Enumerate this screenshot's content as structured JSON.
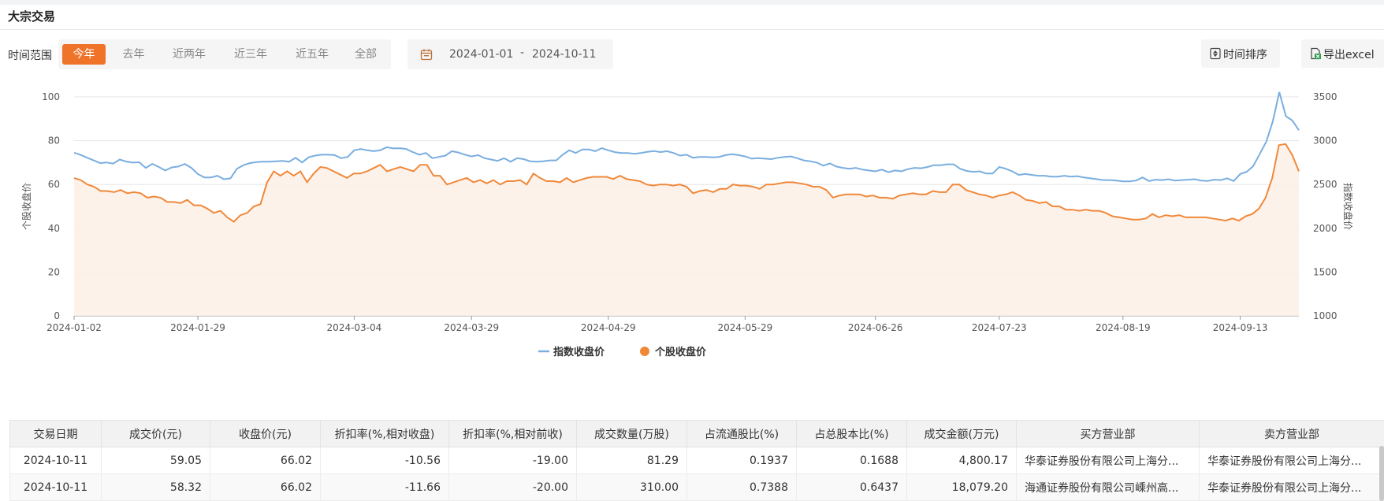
{
  "header": {
    "title": "大宗交易"
  },
  "filter": {
    "label": "时间范围",
    "ranges": [
      "今年",
      "去年",
      "近两年",
      "近三年",
      "近五年",
      "全部"
    ],
    "active_index": 0,
    "date_from": "2024-01-01",
    "date_sep": "-",
    "date_to": "2024-10-11"
  },
  "toolbar": {
    "sort_label": "时间排序",
    "export_label": "导出excel"
  },
  "icons": {
    "calendar": "calendar-icon",
    "sort": "sort-icon",
    "export": "excel-export-icon"
  },
  "colors": {
    "accent": "#f0732a",
    "stock_line": "#f0883a",
    "index_line": "#7aaedf",
    "stock_fill": "#fdf0e6"
  },
  "chart_data": {
    "type": "line",
    "x_ticks": [
      "2024-01-02",
      "2024-01-29",
      "2024-03-04",
      "2024-03-29",
      "2024-04-29",
      "2024-05-29",
      "2024-06-26",
      "2024-07-23",
      "2024-08-19",
      "2024-09-13"
    ],
    "ylabel_left": "个股收盘价",
    "ylabel_right": "指数收盘价",
    "ylim_left": [
      0,
      100
    ],
    "ylim_right": [
      1000,
      3500
    ],
    "y_ticks_left": [
      "0",
      "20",
      "40",
      "60",
      "80",
      "100"
    ],
    "y_ticks_right": [
      "1000",
      "1500",
      "2000",
      "2500",
      "3000",
      "3500"
    ],
    "legend_position": "bottom",
    "grid": true,
    "series": [
      {
        "name": "指数收盘价",
        "axis": "right",
        "values": [
          2862,
          2838,
          2806,
          2775,
          2744,
          2752,
          2738,
          2785,
          2762,
          2750,
          2754,
          2690,
          2735,
          2700,
          2660,
          2695,
          2705,
          2735,
          2690,
          2620,
          2580,
          2580,
          2600,
          2560,
          2570,
          2680,
          2720,
          2745,
          2755,
          2760,
          2760,
          2765,
          2770,
          2760,
          2805,
          2752,
          2810,
          2830,
          2840,
          2840,
          2835,
          2800,
          2815,
          2890,
          2905,
          2890,
          2880,
          2890,
          2925,
          2912,
          2915,
          2905,
          2870,
          2840,
          2860,
          2800,
          2815,
          2830,
          2880,
          2865,
          2840,
          2820,
          2835,
          2800,
          2785,
          2770,
          2800,
          2760,
          2800,
          2790,
          2765,
          2760,
          2765,
          2775,
          2775,
          2840,
          2890,
          2860,
          2900,
          2900,
          2880,
          2915,
          2890,
          2870,
          2860,
          2860,
          2850,
          2860,
          2872,
          2882,
          2870,
          2880,
          2860,
          2830,
          2840,
          2805,
          2815,
          2815,
          2810,
          2815,
          2835,
          2845,
          2835,
          2820,
          2795,
          2800,
          2795,
          2790,
          2805,
          2815,
          2820,
          2800,
          2775,
          2765,
          2750,
          2715,
          2740,
          2705,
          2690,
          2680,
          2690,
          2670,
          2660,
          2650,
          2670,
          2640,
          2660,
          2650,
          2675,
          2690,
          2685,
          2700,
          2720,
          2720,
          2730,
          2730,
          2680,
          2655,
          2645,
          2650,
          2625,
          2625,
          2700,
          2680,
          2650,
          2610,
          2620,
          2610,
          2600,
          2600,
          2590,
          2590,
          2600,
          2590,
          2595,
          2580,
          2570,
          2560,
          2550,
          2550,
          2545,
          2535,
          2535,
          2545,
          2580,
          2540,
          2555,
          2550,
          2560,
          2545,
          2550,
          2555,
          2560,
          2545,
          2540,
          2555,
          2550,
          2570,
          2540,
          2620,
          2645,
          2710,
          2850,
          2990,
          3220,
          3555,
          3280,
          3230,
          3120
        ],
        "note_scale": "values expressed on left-axis equivalent ×1 of right axis via ylim_right"
      },
      {
        "name": "个股收盘价",
        "axis": "left",
        "values": [
          63,
          62,
          60,
          59,
          57,
          57,
          56.5,
          57.5,
          56,
          56.5,
          56,
          54,
          54.5,
          54,
          52,
          52,
          51.5,
          53,
          50.5,
          50.5,
          49,
          47,
          48,
          45,
          43,
          46,
          47,
          50,
          51,
          61,
          66,
          64,
          66,
          64,
          66,
          61,
          65,
          68,
          67.5,
          66,
          64.5,
          63,
          65,
          65,
          66,
          67.5,
          69,
          66,
          67,
          68,
          67,
          66,
          69,
          69,
          64,
          64,
          60,
          61,
          62,
          63,
          61,
          62,
          60.5,
          62,
          60,
          61.5,
          61.5,
          62,
          60,
          65,
          63,
          61.5,
          61.5,
          61,
          63,
          61,
          62,
          63,
          63.5,
          63.5,
          63.5,
          62.5,
          64,
          62.5,
          62,
          61.5,
          60,
          59.5,
          60,
          60,
          59.5,
          60,
          59,
          56,
          57,
          57.5,
          56.5,
          58,
          58,
          60,
          59.5,
          59.5,
          59,
          58,
          60,
          60,
          60.5,
          61,
          61,
          60.5,
          60,
          59,
          59,
          57.5,
          54,
          55,
          55.5,
          55.5,
          55.5,
          54.5,
          55,
          54,
          54,
          53.5,
          55,
          55.5,
          56,
          55.5,
          55.5,
          57,
          56.5,
          56.5,
          60,
          60,
          57.5,
          56.5,
          55.5,
          55,
          54,
          55,
          55.5,
          56.5,
          55,
          53,
          52.5,
          51.5,
          52,
          50,
          50,
          48.5,
          48.5,
          48,
          48.5,
          48,
          48,
          47,
          45.5,
          45,
          44.5,
          44,
          44,
          44.5,
          46.5,
          45,
          46,
          45.5,
          46,
          45,
          45,
          45,
          45,
          44.5,
          44,
          43.5,
          44.5,
          43.5,
          45.5,
          46.5,
          49,
          54,
          63,
          78,
          78.5,
          73.5,
          66
        ],
        "note_scale": "left axis values"
      }
    ]
  },
  "table": {
    "columns": [
      "交易日期",
      "成交价(元)",
      "收盘价(元)",
      "折扣率(%,相对收盘)",
      "折扣率(%,相对前收)",
      "成交数量(万股)",
      "占流通股比(%)",
      "占总股本比(%)",
      "成交金额(万元)",
      "买方营业部",
      "卖方营业部"
    ],
    "rows": [
      [
        "2024-10-11",
        "59.05",
        "66.02",
        "-10.56",
        "-19.00",
        "81.29",
        "0.1937",
        "0.1688",
        "4,800.17",
        "华泰证券股份有限公司上海分...",
        "华泰证券股份有限公司上海分..."
      ],
      [
        "2024-10-11",
        "58.32",
        "66.02",
        "-11.66",
        "-20.00",
        "310.00",
        "0.7388",
        "0.6437",
        "18,079.20",
        "海通证券股份有限公司嵊州高...",
        "华泰证券股份有限公司上海分..."
      ]
    ]
  }
}
